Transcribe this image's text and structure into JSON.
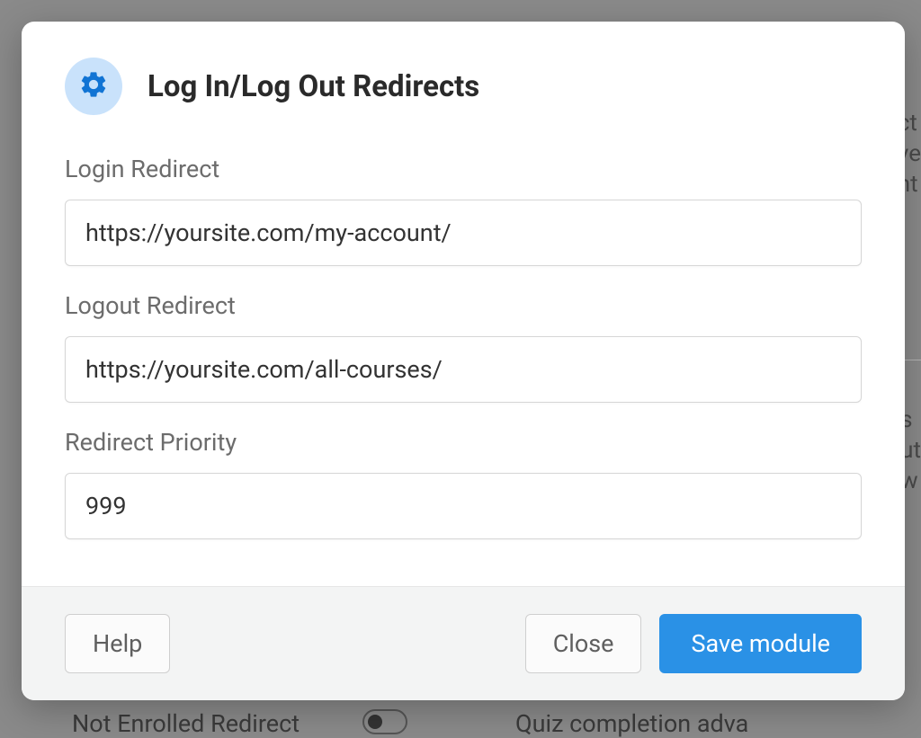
{
  "modal": {
    "title": "Log In/Log Out Redirects",
    "icon": "gear-icon",
    "fields": {
      "login_redirect": {
        "label": "Login Redirect",
        "value": "https://yoursite.com/my-account/"
      },
      "logout_redirect": {
        "label": "Logout Redirect",
        "value": "https://yoursite.com/all-courses/"
      },
      "redirect_priority": {
        "label": "Redirect Priority",
        "value": "999"
      }
    },
    "footer": {
      "help_label": "Help",
      "close_label": "Close",
      "save_label": "Save module"
    }
  },
  "background": {
    "fragment1": "ct\nve\nnt",
    "fragment2": "s\nut\nw",
    "bottom_left": "Not Enrolled Redirect",
    "bottom_right": "Quiz completion adva"
  }
}
